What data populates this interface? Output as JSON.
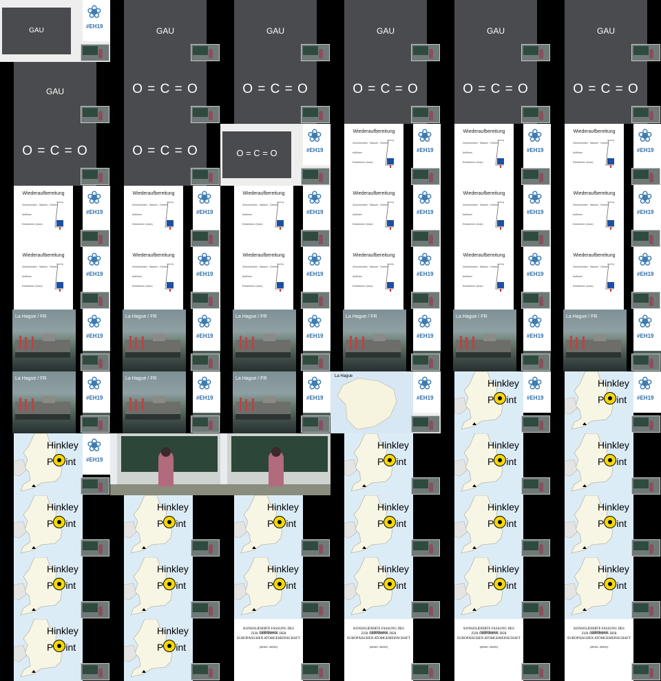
{
  "slides": {
    "gau": "GAU",
    "oco": "O = C = O",
    "wiederaufbereitung": "Wiederaufbereitung",
    "la_hague_fr": "La Hague / FR",
    "la_hague": "La Hague",
    "hinkley": "Hinkley",
    "point_p": "P",
    "point_int": "int",
    "eh19": "#EH19",
    "wieder_lines": [
      "Zerschneiden · Wasser · Drehen",
      "Auflösen",
      "Extrahieren (Uran)"
    ],
    "treaty_line1": "KONSOLIDIERTE FASSUNG DES VERTRAGS",
    "treaty_line2": "ZUR GRÜNDUNG DER",
    "treaty_line3": "EUROPÄISCHEN ATOMGEMEINSCHAFT",
    "treaty_line4": "(2016/C 203/01)"
  },
  "grid": {
    "columns": 6,
    "rows": 11,
    "tiles": [
      "framed-gau",
      "dark-gau",
      "dark-gau",
      "dark-gau",
      "dark-gau",
      "dark-gau",
      "dark-gau-oco-a",
      "dark-oco",
      "dark-oco",
      "dark-oco",
      "dark-oco",
      "dark-oco",
      "dark-oco-b",
      "dark-oco-b",
      "framed-oco",
      "wieder",
      "wieder",
      "wieder",
      "wieder",
      "wieder",
      "wieder",
      "wieder",
      "wieder",
      "wieder",
      "wieder",
      "wieder",
      "wieder",
      "wieder",
      "wieder",
      "wieder",
      "photo",
      "photo",
      "photo",
      "photo",
      "photo",
      "photo",
      "photo",
      "photo",
      "photo",
      "map-fr",
      "map-hk",
      "map-hk",
      "map-hk",
      "lecture",
      "lecture",
      "hk",
      "hk",
      "hk",
      "hk",
      "hk",
      "hk",
      "hk",
      "hk",
      "hk",
      "hk",
      "hk",
      "hk",
      "hk",
      "hk",
      "hk",
      "hk",
      "hk",
      "treaty",
      "treaty",
      "treaty",
      "treaty"
    ]
  },
  "colors": {
    "dark_slide": "#4a4b4f",
    "logo_blue": "#3e7cb1",
    "map_water": "#dcecf7",
    "radiation_yellow": "#f4d70a"
  }
}
